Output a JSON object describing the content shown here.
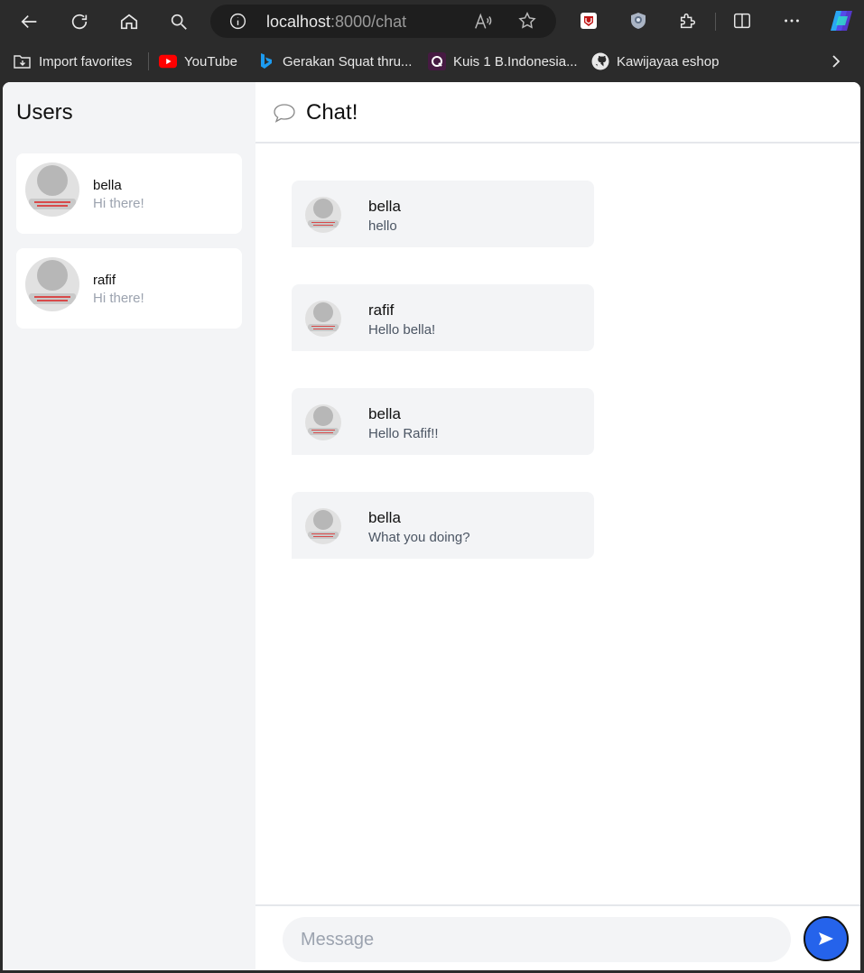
{
  "browser": {
    "url_host": "localhost",
    "url_rest": ":8000/chat",
    "bookmarks": [
      {
        "label": "Import favorites",
        "icon": "import-folder-icon"
      },
      {
        "label": "YouTube",
        "icon": "youtube-icon"
      },
      {
        "label": "Gerakan Squat thru...",
        "icon": "bing-icon"
      },
      {
        "label": "Kuis 1 B.Indonesia...",
        "icon": "quizizz-icon"
      },
      {
        "label": "Kawijayaa eshop",
        "icon": "github-icon"
      }
    ]
  },
  "sidebar": {
    "title": "Users",
    "users": [
      {
        "name": "bella",
        "preview": "Hi there!"
      },
      {
        "name": "rafif",
        "preview": "Hi there!"
      }
    ]
  },
  "chat": {
    "title": "Chat!",
    "messages": [
      {
        "name": "bella",
        "text": "hello"
      },
      {
        "name": "rafif",
        "text": "Hello bella!"
      },
      {
        "name": "bella",
        "text": "Hello Rafif!!"
      },
      {
        "name": "bella",
        "text": "What you doing?"
      }
    ],
    "input_placeholder": "Message"
  },
  "colors": {
    "accent": "#2563eb",
    "sidebar_bg": "#f3f4f6",
    "browser_bg": "#2b2b2b"
  }
}
